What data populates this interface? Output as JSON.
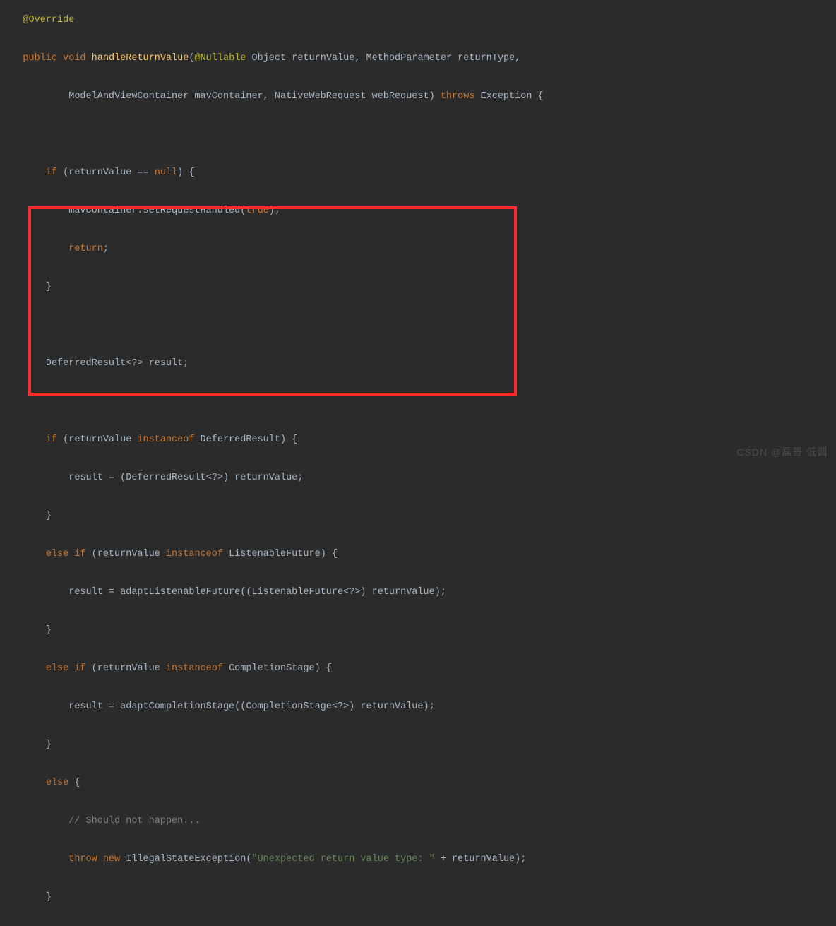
{
  "code": {
    "line1_annotation": "@Override",
    "line2_public": "public",
    "line2_void": "void",
    "line2_method": "handleReturnValue",
    "line2_paren_open": "(",
    "line2_nullable": "@Nullable",
    "line2_rest": " Object returnValue, MethodParameter returnType,",
    "line3": "ModelAndViewContainer mavContainer, NativeWebRequest webRequest) ",
    "line3_throws": "throws",
    "line3_exc": " Exception {",
    "line5_if": "if",
    "line5_cond": " (returnValue == ",
    "line5_null": "null",
    "line5_end": ") {",
    "line6_a": "mavContainer.setRequestHandled(",
    "line6_true": "true",
    "line6_b": ");",
    "line7_return": "return",
    "line7_semi": ";",
    "line8_brace": "}",
    "line10": "DeferredResult<?> result;",
    "line12_if": "if",
    "line12_a": " (returnValue ",
    "line12_io": "instanceof",
    "line12_b": " DeferredResult) {",
    "line13": "result = (DeferredResult<?>) returnValue;",
    "line14_brace": "}",
    "line15_else": "else if",
    "line15_a": " (returnValue ",
    "line15_io": "instanceof",
    "line15_b": " ListenableFuture) {",
    "line16": "result = adaptListenableFuture((ListenableFuture<?>) returnValue);",
    "line17_brace": "}",
    "line18_else": "else if",
    "line18_a": " (returnValue ",
    "line18_io": "instanceof",
    "line18_b": " CompletionStage) {",
    "line19": "result = adaptCompletionStage((CompletionStage<?>) returnValue);",
    "line20_brace": "}",
    "line21_else": "else",
    "line21_b": " {",
    "line22_comment": "// Should not happen...",
    "line23_throw": "throw new",
    "line23_a": " IllegalStateException(",
    "line23_str": "\"Unexpected return value type: \"",
    "line23_b": " + returnValue);",
    "line24_brace": "}"
  },
  "watermark": "CSDN @磊哥 低调"
}
